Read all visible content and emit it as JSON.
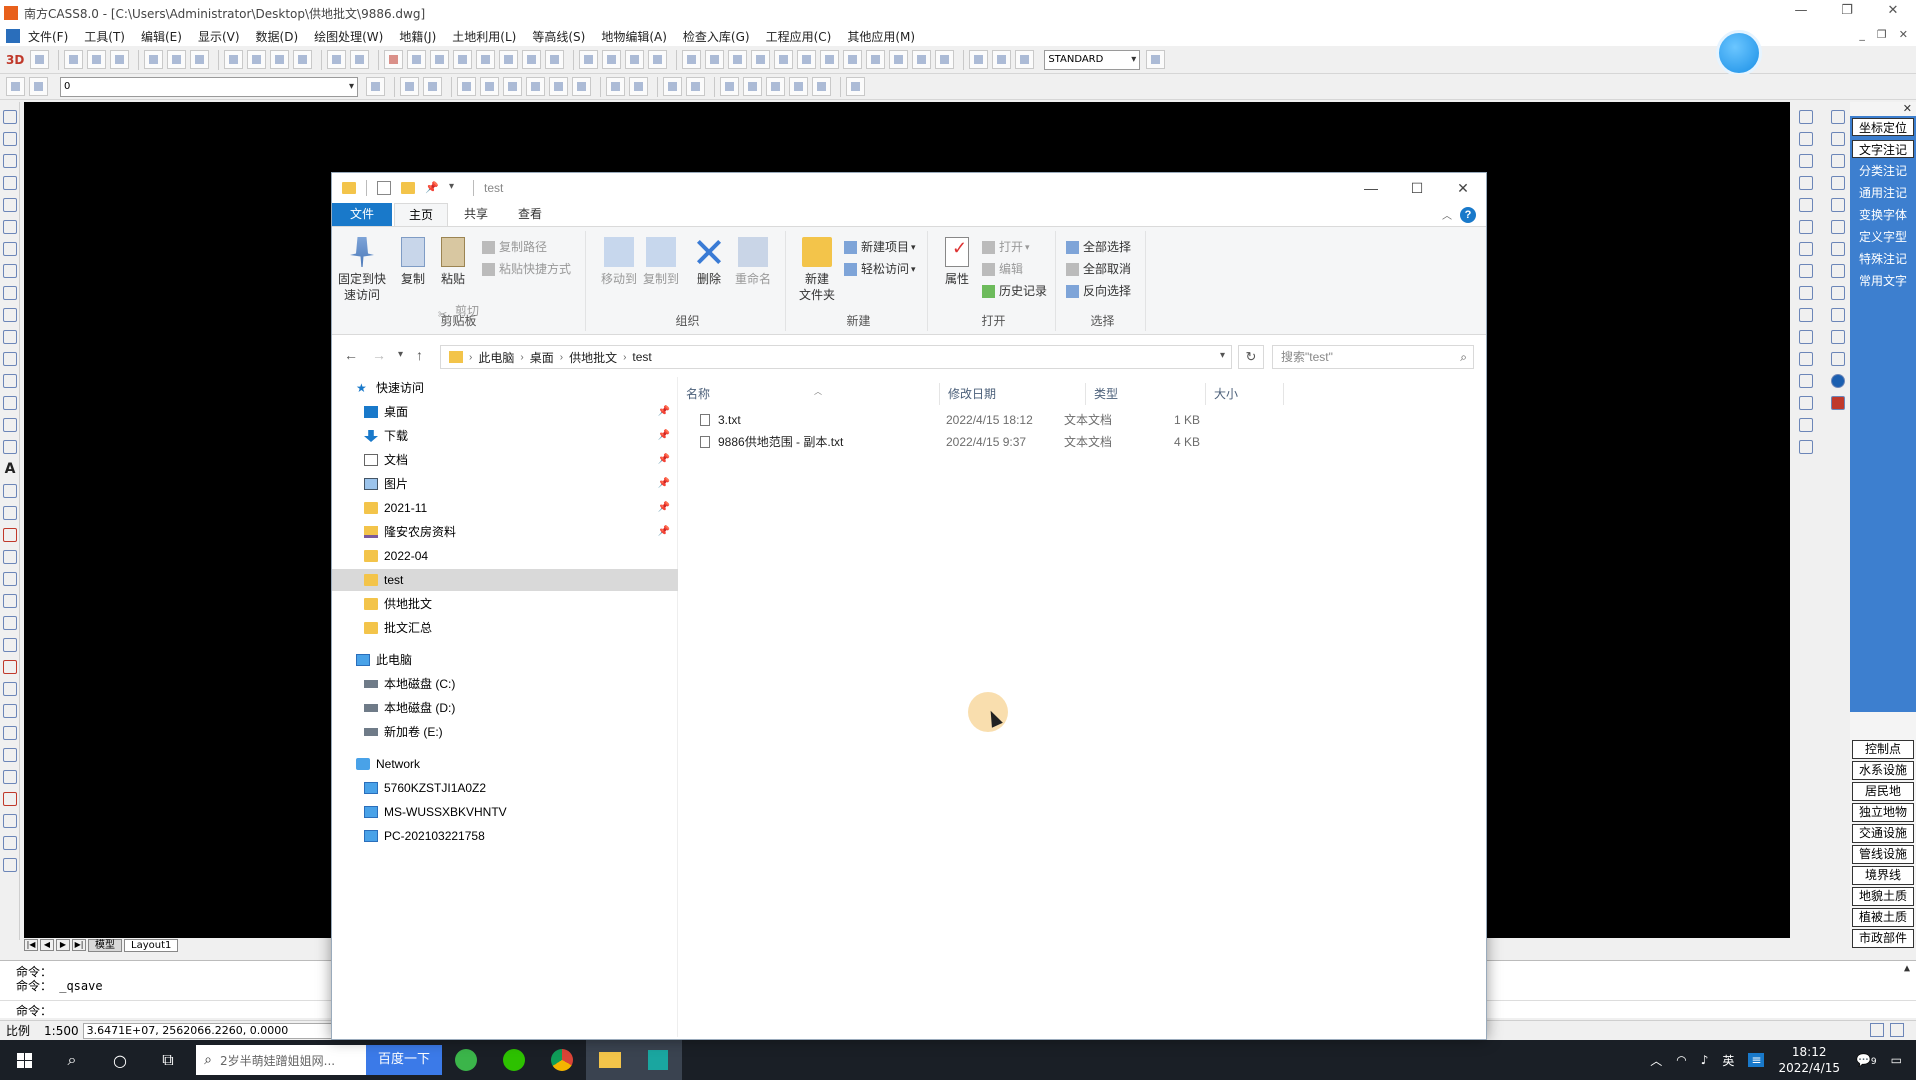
{
  "cad": {
    "title": "南方CASS8.0 - [C:\\Users\\Administrator\\Desktop\\供地批文\\9886.dwg]",
    "menu": [
      "文件(F)",
      "工具(T)",
      "编辑(E)",
      "显示(V)",
      "数据(D)",
      "绘图处理(W)",
      "地籍(J)",
      "土地利用(L)",
      "等高线(S)",
      "地物编辑(A)",
      "检查入库(G)",
      "工程应用(C)",
      "其他应用(M)"
    ],
    "toolbar_3d_label": "3D",
    "text_style": "STANDARD",
    "current_layer": "0",
    "annotation_panel": {
      "buttons": [
        "坐标定位",
        "文字注记",
        "分类注记",
        "通用注记",
        "变换字体",
        "定义字型",
        "特殊注记",
        "常用文字"
      ],
      "categories": [
        "控制点",
        "水系设施",
        "居民地",
        "独立地物",
        "交通设施",
        "管线设施",
        "境界线",
        "地貌土质",
        "植被土质",
        "市政部件"
      ]
    },
    "layout_tabs": [
      "模型",
      "Layout1"
    ],
    "command_lines": [
      "命令：",
      "命令： _qsave",
      "命令："
    ],
    "status": {
      "scale_label": "比例",
      "scale_value": "1:500",
      "coordinates": "3.6471E+07, 2562066.2260, 0.0000"
    }
  },
  "explorer": {
    "title": "test",
    "tabs": {
      "file": "文件",
      "home": "主页",
      "share": "共享",
      "view": "查看"
    },
    "ribbon": {
      "clipboard": {
        "name": "剪贴板",
        "pin": "固定到快\n速访问",
        "copy": "复制",
        "paste": "粘贴",
        "copy_path": "复制路径",
        "paste_shortcut": "粘贴快捷方式",
        "cut": "剪切"
      },
      "organize": {
        "name": "组织",
        "move_to": "移动到",
        "copy_to": "复制到",
        "delete": "删除",
        "rename": "重命名"
      },
      "new": {
        "name": "新建",
        "new_item": "新建项目",
        "easy_access": "轻松访问",
        "new_folder": "新建\n文件夹"
      },
      "open": {
        "name": "打开",
        "properties": "属性",
        "open": "打开",
        "edit": "编辑",
        "history": "历史记录"
      },
      "select": {
        "name": "选择",
        "select_all": "全部选择",
        "select_none": "全部取消",
        "invert": "反向选择"
      }
    },
    "breadcrumb": [
      "此电脑",
      "桌面",
      "供地批文",
      "test"
    ],
    "search_placeholder": "搜索\"test\"",
    "nav": {
      "quick_access": "快速访问",
      "quick_items": [
        {
          "label": "桌面",
          "pinned": true
        },
        {
          "label": "下载",
          "pinned": true
        },
        {
          "label": "文档",
          "pinned": true
        },
        {
          "label": "图片",
          "pinned": true
        },
        {
          "label": "2021-11",
          "pinned": true
        },
        {
          "label": "隆安农房资料",
          "pinned": true
        },
        {
          "label": "2022-04",
          "pinned": false
        },
        {
          "label": "test",
          "pinned": false
        },
        {
          "label": "供地批文",
          "pinned": false
        },
        {
          "label": "批文汇总",
          "pinned": false
        }
      ],
      "this_pc": "此电脑",
      "drives": [
        "本地磁盘 (C:)",
        "本地磁盘 (D:)",
        "新加卷 (E:)"
      ],
      "network": "Network",
      "computers": [
        "5760KZSTJI1A0Z2",
        "MS-WUSSXBKVHNTV",
        "PC-202103221758"
      ]
    },
    "columns": {
      "name": "名称",
      "date": "修改日期",
      "type": "类型",
      "size": "大小"
    },
    "files": [
      {
        "name": "3.txt",
        "date": "2022/4/15 18:12",
        "type": "文本文档",
        "size": "1 KB"
      },
      {
        "name": "9886供地范围 - 副本.txt",
        "date": "2022/4/15 9:37",
        "type": "文本文档",
        "size": "4 KB"
      }
    ]
  },
  "taskbar": {
    "search_text": "2岁半萌娃蹭姐姐网...",
    "search_button": "百度一下",
    "ime": "英",
    "time": "18:12",
    "date": "2022/4/15",
    "notification_count": "9"
  }
}
